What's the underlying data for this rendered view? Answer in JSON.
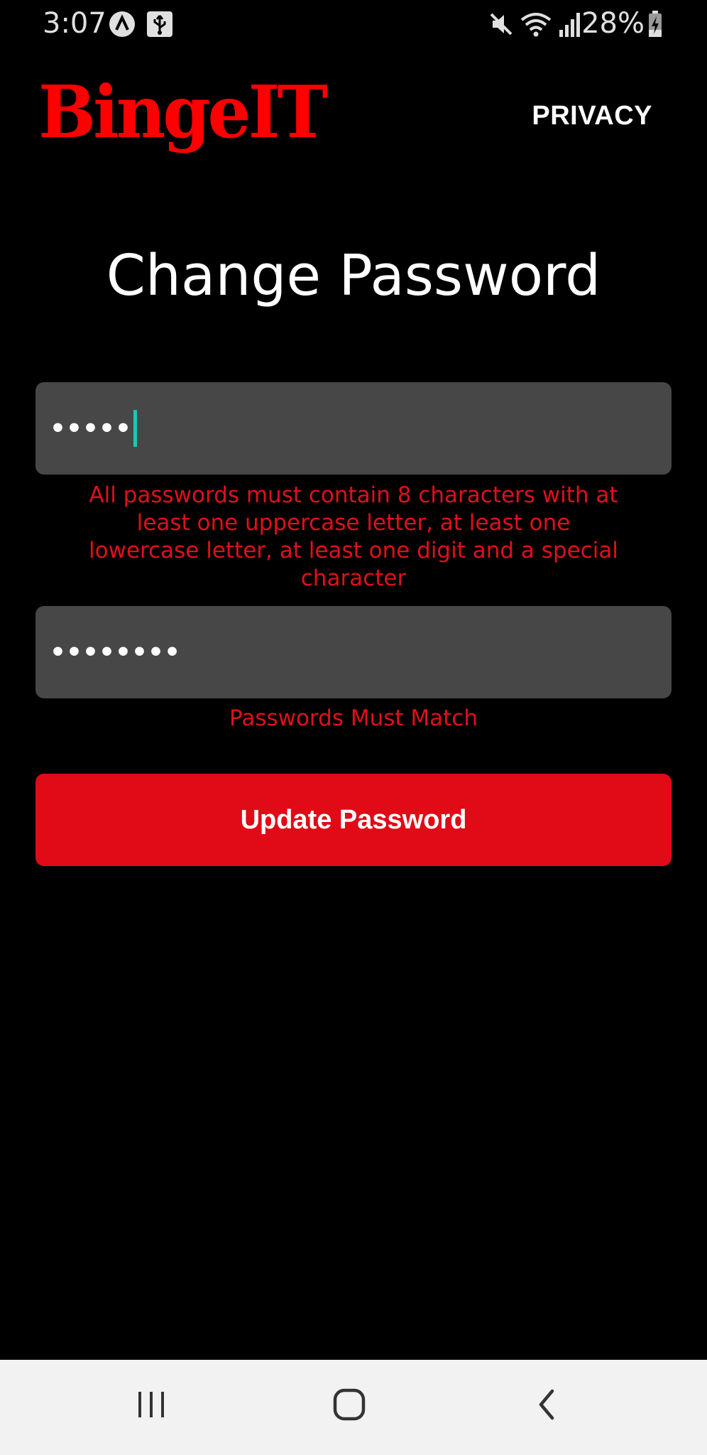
{
  "status_bar": {
    "time": "3:07",
    "battery": "28%",
    "icons": [
      "app-notification-icon",
      "usb-icon",
      "mute-icon",
      "wifi-icon",
      "signal-icon",
      "battery-charging-icon"
    ]
  },
  "header": {
    "logo": "BingeIT",
    "privacy_label": "PRIVACY"
  },
  "main": {
    "title": "Change Password",
    "new_password": {
      "value_masked": "•••••"
    },
    "new_password_error": "All passwords must contain 8 characters with at least one uppercase letter, at least one lowercase letter, at least one digit and a special character",
    "confirm_password": {
      "value_masked": "••••••••"
    },
    "confirm_password_error": "Passwords Must Match",
    "update_button_label": "Update Password"
  },
  "nav_bar": {
    "icons": [
      "recent-apps-icon",
      "home-icon",
      "back-icon"
    ]
  },
  "colors": {
    "background": "#000000",
    "accent": "#e10a17",
    "logo": "#ff0000",
    "error": "#e0101a",
    "field": "#474747",
    "caret": "#18c8b8"
  }
}
